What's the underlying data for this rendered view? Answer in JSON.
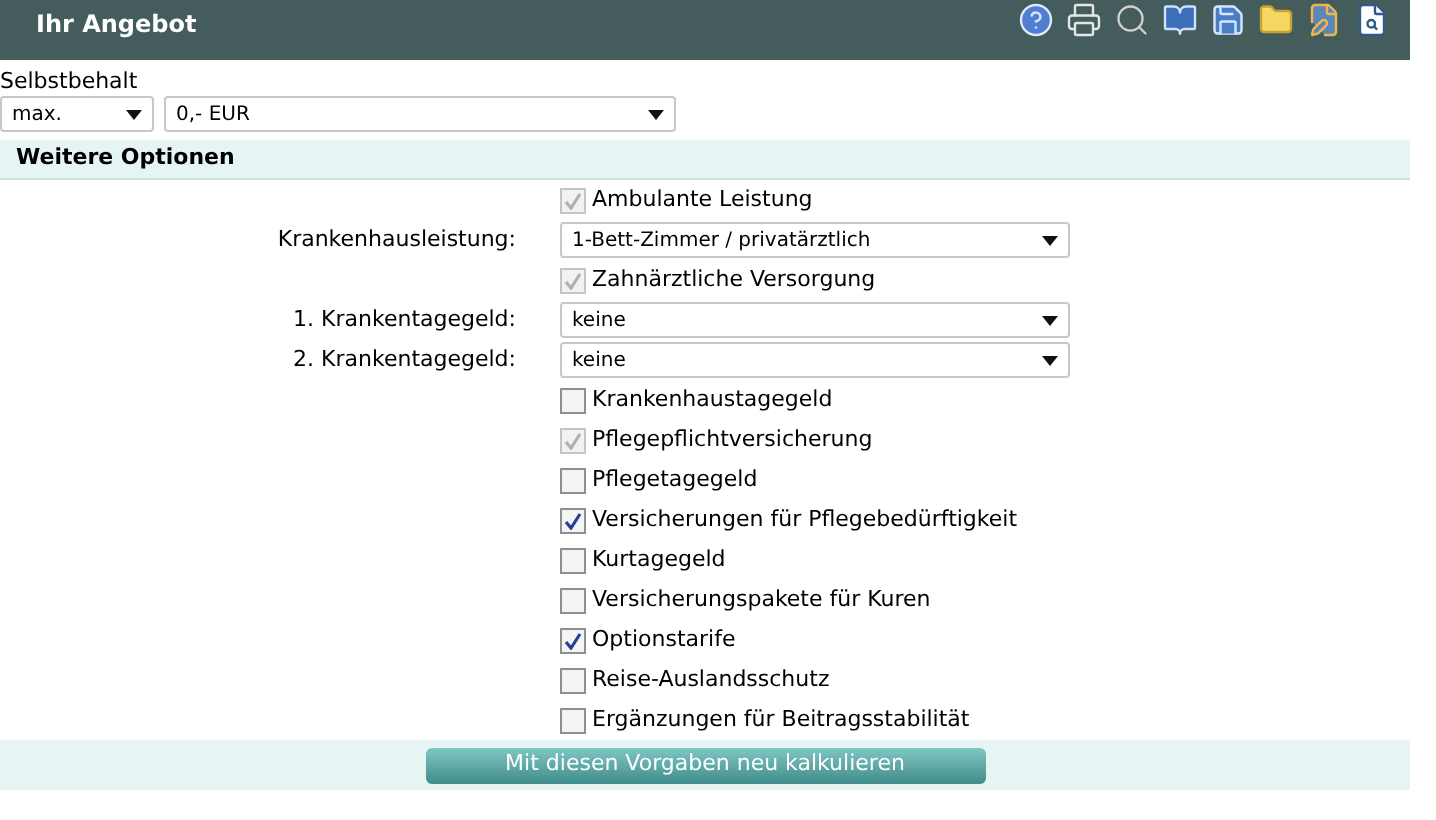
{
  "header": {
    "title": "Ihr Angebot"
  },
  "deductible": {
    "label": "Selbstbehalt",
    "mode": "max.",
    "amount": "0,- EUR"
  },
  "section": {
    "title": "Weitere Optionen"
  },
  "options": [
    {
      "kind": "checkbox",
      "label": "Ambulante Leistung",
      "checked": true,
      "disabled": true
    },
    {
      "kind": "select",
      "label": "Krankenhausleistung:",
      "value": "1-Bett-Zimmer / privatärztlich"
    },
    {
      "kind": "checkbox",
      "label": "Zahnärztliche Versorgung",
      "checked": true,
      "disabled": true
    },
    {
      "kind": "select",
      "label": "1. Krankentagegeld:",
      "value": "keine"
    },
    {
      "kind": "select",
      "label": "2. Krankentagegeld:",
      "value": "keine"
    },
    {
      "kind": "checkbox",
      "label": "Krankenhaustagegeld",
      "checked": false,
      "disabled": false
    },
    {
      "kind": "checkbox",
      "label": "Pflegepflichtversicherung",
      "checked": true,
      "disabled": true
    },
    {
      "kind": "checkbox",
      "label": "Pflegetagegeld",
      "checked": false,
      "disabled": false
    },
    {
      "kind": "checkbox",
      "label": "Versicherungen für Pflegebedürftigkeit",
      "checked": true,
      "disabled": false
    },
    {
      "kind": "checkbox",
      "label": "Kurtagegeld",
      "checked": false,
      "disabled": false
    },
    {
      "kind": "checkbox",
      "label": "Versicherungspakete für Kuren",
      "checked": false,
      "disabled": false
    },
    {
      "kind": "checkbox",
      "label": "Optionstarife",
      "checked": true,
      "disabled": false
    },
    {
      "kind": "checkbox",
      "label": "Reise-Auslandsschutz",
      "checked": false,
      "disabled": false
    },
    {
      "kind": "checkbox",
      "label": "Ergänzungen für Beitragsstabilität",
      "checked": false,
      "disabled": false
    }
  ],
  "button": {
    "label": "Mit diesen Vorgaben neu kalkulieren"
  }
}
